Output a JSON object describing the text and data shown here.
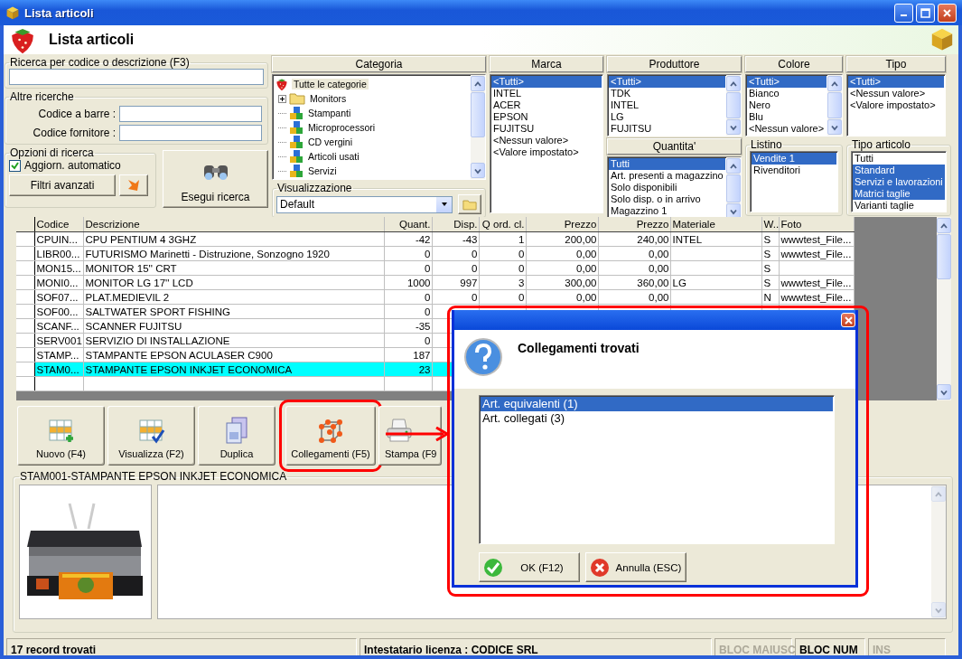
{
  "window": {
    "title": "Lista articoli"
  },
  "header": {
    "title": "Lista articoli"
  },
  "search": {
    "legend": "Ricerca per codice o descrizione (F3)"
  },
  "other_searches": {
    "legend": "Altre ricerche",
    "fields": [
      {
        "label": "Codice a barre :"
      },
      {
        "label": "Codice fornitore :"
      }
    ]
  },
  "options": {
    "legend": "Opzioni di ricerca",
    "auto_update": {
      "label": "Aggiorn. automatico",
      "checked": true
    },
    "advanced_button": "Filtri avanzati"
  },
  "run_button": "Esegui ricerca",
  "category": {
    "title": "Categoria",
    "tree": [
      {
        "label": "Tutte le categorie",
        "selected": true,
        "children": [
          {
            "label": "Monitors",
            "kind": "folder",
            "expandable": true,
            "selected": false
          },
          {
            "label": "Stampanti",
            "kind": "group",
            "expandable": false,
            "selected": false
          },
          {
            "label": "Microprocessori",
            "kind": "group",
            "expandable": false,
            "selected": false
          },
          {
            "label": "CD vergini",
            "kind": "group",
            "expandable": false,
            "selected": false
          },
          {
            "label": "Articoli usati",
            "kind": "group",
            "expandable": false,
            "selected": false
          },
          {
            "label": "Servizi",
            "kind": "group",
            "expandable": false,
            "selected": false
          }
        ]
      }
    ]
  },
  "view": {
    "legend": "Visualizzazione",
    "value": "Default"
  },
  "marca": {
    "title": "Marca",
    "items": [
      {
        "label": "<Tutti>",
        "selected": true
      },
      {
        "label": "INTEL",
        "selected": false
      },
      {
        "label": "ACER",
        "selected": false
      },
      {
        "label": "EPSON",
        "selected": false
      },
      {
        "label": "FUJITSU",
        "selected": false
      },
      {
        "label": "<Nessun valore>",
        "selected": false
      },
      {
        "label": "<Valore impostato>",
        "selected": false
      }
    ]
  },
  "produttore": {
    "title": "Produttore",
    "items": [
      {
        "label": "<Tutti>",
        "selected": true
      },
      {
        "label": "TDK",
        "selected": false
      },
      {
        "label": "INTEL",
        "selected": false
      },
      {
        "label": "LG",
        "selected": false
      },
      {
        "label": "FUJITSU",
        "selected": false
      }
    ]
  },
  "quantita": {
    "title": "Quantita'",
    "items": [
      {
        "label": "Tutti",
        "selected": true
      },
      {
        "label": "Art. presenti a magazzino",
        "selected": false
      },
      {
        "label": "Solo disponibili",
        "selected": false
      },
      {
        "label": "Solo disp. o in arrivo",
        "selected": false
      },
      {
        "label": "Magazzino 1",
        "selected": false
      }
    ]
  },
  "colore": {
    "title": "Colore",
    "items": [
      {
        "label": "<Tutti>",
        "selected": true
      },
      {
        "label": "Bianco",
        "selected": false
      },
      {
        "label": "Nero",
        "selected": false
      },
      {
        "label": "Blu",
        "selected": false
      },
      {
        "label": "<Nessun valore>",
        "selected": false
      }
    ]
  },
  "listino": {
    "title": "Listino",
    "items": [
      {
        "label": "Vendite 1",
        "selected": true
      },
      {
        "label": "Rivenditori",
        "selected": false
      }
    ]
  },
  "tipo": {
    "title": "Tipo",
    "items": [
      {
        "label": "<Tutti>",
        "selected": true
      },
      {
        "label": "<Nessun valore>",
        "selected": false
      },
      {
        "label": "<Valore impostato>",
        "selected": false
      }
    ]
  },
  "tipo_articolo": {
    "title": "Tipo articolo",
    "items": [
      {
        "label": "Tutti",
        "selected": false
      },
      {
        "label": "Standard",
        "selected": true
      },
      {
        "label": "Servizi e lavorazioni",
        "selected": true
      },
      {
        "label": "Matrici taglie",
        "selected": true
      },
      {
        "label": "Varianti taglie",
        "selected": false
      }
    ]
  },
  "table": {
    "columns": [
      "Codice",
      "Descrizione",
      "Quant.",
      "Disp.",
      "Q ord. cl.",
      "Prezzo",
      "Prezzo",
      "Materiale",
      "W..",
      "Foto"
    ],
    "rows": [
      {
        "selected": false,
        "cells": [
          "CPUIN...",
          "CPU PENTIUM 4 3GHZ",
          "-42",
          "-43",
          "1",
          "200,00",
          "240,00",
          "INTEL",
          "S",
          "wwwtest_File..."
        ]
      },
      {
        "selected": false,
        "cells": [
          "LIBR00...",
          "FUTURISMO Marinetti - Distruzione, Sonzogno 1920",
          "0",
          "0",
          "0",
          "0,00",
          "0,00",
          null,
          "S",
          "wwwtest_File..."
        ]
      },
      {
        "selected": false,
        "cells": [
          "MON15...",
          "MONITOR 15'' CRT",
          "0",
          "0",
          "0",
          "0,00",
          "0,00",
          null,
          "S",
          null
        ]
      },
      {
        "selected": false,
        "cells": [
          "MONI0...",
          "MONITOR LG 17'' LCD",
          "1000",
          "997",
          "3",
          "300,00",
          "360,00",
          "LG",
          "S",
          "wwwtest_File..."
        ]
      },
      {
        "selected": false,
        "cells": [
          "SOF07...",
          "PLAT.MEDIEVIL 2",
          "0",
          "0",
          "0",
          "0,00",
          "0,00",
          null,
          "N",
          "wwwtest_File..."
        ]
      },
      {
        "selected": false,
        "cells": [
          "SOF00...",
          "SALTWATER SPORT FISHING",
          "0"
        ]
      },
      {
        "selected": false,
        "cells": [
          "SCANF...",
          "SCANNER FUJITSU",
          "-35"
        ]
      },
      {
        "selected": false,
        "cells": [
          "SERV001",
          "SERVIZIO DI INSTALLAZIONE",
          "0"
        ]
      },
      {
        "selected": false,
        "cells": [
          "STAMP...",
          "STAMPANTE EPSON ACULASER C900",
          "187"
        ]
      },
      {
        "selected": true,
        "cells": [
          "STAM0...",
          "STAMPANTE EPSON INKJET ECONOMICA",
          "23"
        ]
      }
    ]
  },
  "toolbar": [
    {
      "label": "Nuovo (F4)",
      "kind": "new",
      "highlighted": false
    },
    {
      "label": "Visualizza (F2)",
      "kind": "view",
      "highlighted": false
    },
    {
      "label": "Duplica",
      "kind": "duplicate",
      "highlighted": false
    },
    {
      "label": "Collegamenti (F5)",
      "kind": "links",
      "highlighted": true
    },
    {
      "label": "Stampa (F9",
      "kind": "print",
      "highlighted": false
    }
  ],
  "detail": {
    "title": "STAM001-STAMPANTE EPSON INKJET ECONOMICA"
  },
  "dialog": {
    "heading": "Collegamenti trovati",
    "highlighted": true,
    "items": [
      {
        "label": "Art. equivalenti (1)",
        "selected": true
      },
      {
        "label": "Art. collegati (3)",
        "selected": false
      }
    ],
    "buttons": [
      {
        "label": "OK (F12)",
        "kind": "ok"
      },
      {
        "label": "Annulla (ESC)",
        "kind": "cancel"
      }
    ]
  },
  "status_bar": {
    "message": "17 record trovati",
    "license": "Intestatario licenza : CODICE SRL",
    "indicators": [
      {
        "label": "BLOC MAIUSC",
        "on": false
      },
      {
        "label": "BLOC NUM",
        "on": true
      },
      {
        "label": "INS",
        "on": false
      }
    ]
  }
}
